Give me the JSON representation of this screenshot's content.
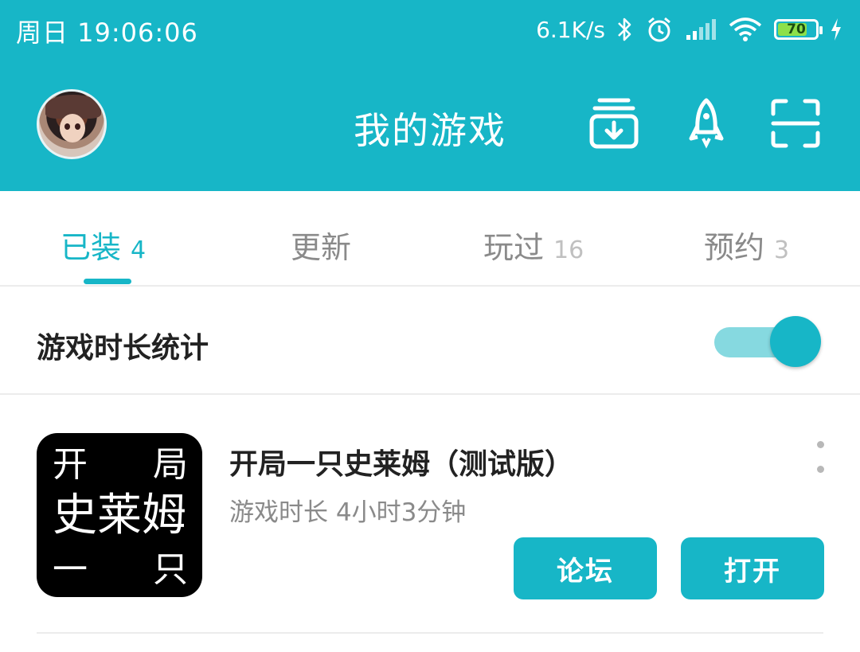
{
  "status_bar": {
    "time": "周日 19:06:06",
    "net_speed": "6.1K/s",
    "battery": "70",
    "battery_level": 0.7,
    "icons": [
      "bluetooth-icon",
      "alarm-icon",
      "signal-icon",
      "wifi-icon",
      "battery-icon",
      "charging-icon"
    ]
  },
  "header": {
    "title": "我的游戏",
    "icons": [
      "download-icon",
      "rocket-icon",
      "scan-icon"
    ],
    "background_color": "#17b6c7"
  },
  "tabs": [
    {
      "label": "已装",
      "count": "4"
    },
    {
      "label": "更新",
      "count": ""
    },
    {
      "label": "玩过",
      "count": "16"
    },
    {
      "label": "预约",
      "count": "3"
    }
  ],
  "stats": {
    "label": "游戏时长统计",
    "toggle_on": true
  },
  "games": [
    {
      "title": "开局一只史莱姆（测试版）",
      "playtime": "游戏时长 4小时3分钟",
      "icon_chars": [
        "开",
        "局",
        "史莱姆",
        "一",
        "只"
      ],
      "forum_label": "论坛",
      "open_label": "打开"
    }
  ],
  "colors": {
    "accent": "#17b6c7",
    "toggle_track": "#86d9e0",
    "text_primary": "#222222",
    "text_secondary": "#8a8a8a"
  }
}
